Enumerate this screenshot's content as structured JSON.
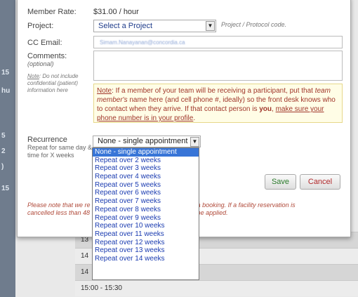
{
  "background": {
    "side_marks": [
      "15",
      "hu",
      "5",
      "2",
      ")",
      "15"
    ],
    "time_rows": [
      "13",
      "14",
      "14",
      "15:00 - 15:30"
    ]
  },
  "form": {
    "member_rate": {
      "label": "Member Rate:",
      "value": "$31.00 / hour"
    },
    "project": {
      "label": "Project:",
      "selected": "Select a Project",
      "hint": "Project / Protocol code."
    },
    "cc_email": {
      "label": "CC Email:",
      "value": "Simam.Nanayanan@concordia.ca"
    },
    "comments": {
      "label": "Comments:",
      "sublabel": "(optional)",
      "value": ""
    },
    "side_note": {
      "prefix": "Note",
      "text": ": Do not include confidential (patient) information here"
    },
    "note": {
      "prefix": "Note",
      "text1": ": If a member of your team will be receiving a participant, put that ",
      "italic1": "team member's",
      "text2": " name here (and cell phone #, ideally) so the front desk knows who to contact when they arrive. If that contact person is ",
      "bold1": "you",
      "text3": ", ",
      "link": "make sure your phone number is in your profile",
      "text4": "."
    },
    "recurrence": {
      "label": "Recurrence",
      "sublabel": "Repeat for same day & time for X weeks",
      "selected": "None - single appointment",
      "options": [
        "None - single appointment",
        "Repeat over 2 weeks",
        "Repeat over 3 weeks",
        "Repeat over 4 weeks",
        "Repeat over 5 weeks",
        "Repeat over 6 weeks",
        "Repeat over 7 weeks",
        "Repeat over 8 weeks",
        "Repeat over 9 weeks",
        "Repeat over 10 weeks",
        "Repeat over 11 weeks",
        "Repeat over 12 weeks",
        "Repeat over 13 weeks",
        "Repeat over 14 weeks"
      ]
    },
    "buttons": {
      "save": "Save",
      "cancel": "Cancel"
    },
    "footnote_left": "Please note that we re",
    "footnote_left2": "cancelled less than 48",
    "footnote_right": "cel a booking. If a facility reservation is",
    "footnote_right2": "ll be applied."
  },
  "colors": {
    "cancel_text": "#b0282a",
    "save_text": "#2a7a2a",
    "selected_option": "#3875d7"
  },
  "icons": {
    "dropdown": "chevron-down-icon"
  }
}
